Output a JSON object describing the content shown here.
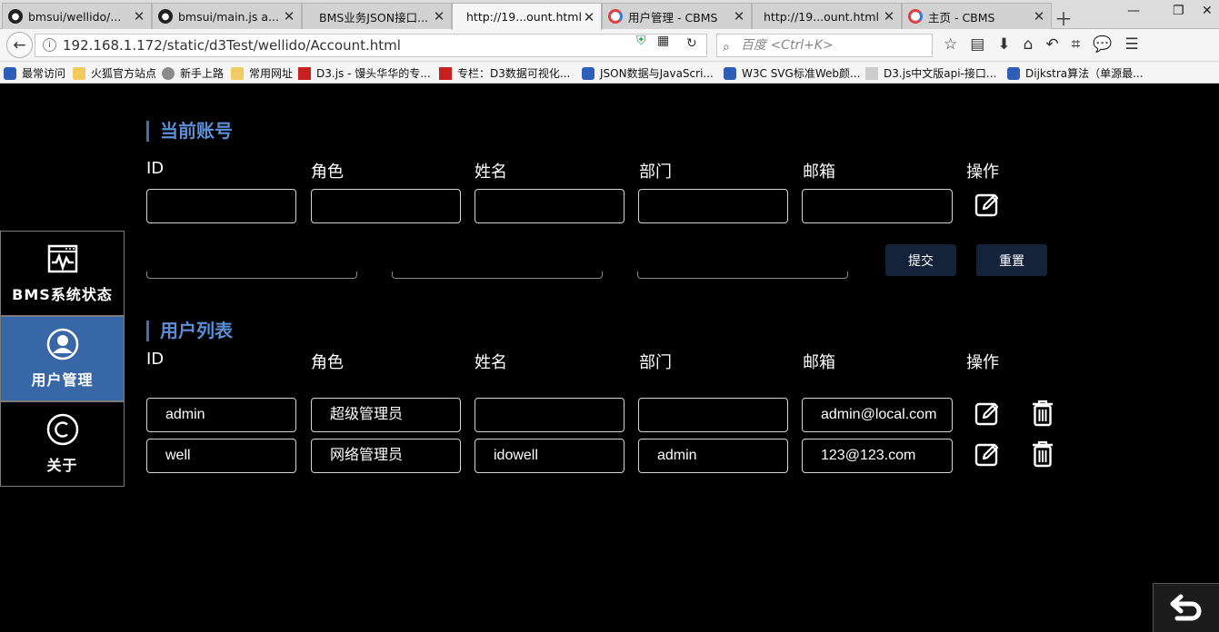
{
  "browser": {
    "tabs": [
      {
        "label": "bmsui/wellido/...",
        "icon": "github-icon"
      },
      {
        "label": "bmsui/main.js a...",
        "icon": "github-icon"
      },
      {
        "label": "BMS业务JSON接口...",
        "icon": ""
      },
      {
        "label": "http://19...ount.html",
        "icon": ""
      },
      {
        "label": "用户管理 - CBMS",
        "icon": "cbms-icon"
      },
      {
        "label": "http://19...ount.html",
        "icon": ""
      },
      {
        "label": "主页 - CBMS",
        "icon": "cbms-icon"
      }
    ],
    "url": "192.168.1.172/static/d3Test/wellido/Account.html",
    "search_placeholder": "百度 <Ctrl+K>",
    "bookmarks": [
      "最常访问",
      "火狐官方站点",
      "新手上路",
      "常用网址",
      "D3.js - 馒头华华的专...",
      "专栏：D3数据可视化...",
      "JSON数据与JavaScri...",
      "W3C SVG标准Web颜...",
      "D3.js中文版api-接口...",
      "Dijkstra算法（单源最..."
    ]
  },
  "sidebar": {
    "items": [
      {
        "label": "BMS系统状态",
        "icon": "monitor-wave-icon",
        "active": false
      },
      {
        "label": "用户管理",
        "icon": "user-icon",
        "active": true
      },
      {
        "label": "关于",
        "icon": "copyright-icon",
        "active": false
      }
    ]
  },
  "current_account": {
    "title": "当前账号",
    "headers": [
      "ID",
      "角色",
      "姓名",
      "部门",
      "邮箱",
      "操作"
    ],
    "values": [
      "",
      "",
      "",
      "",
      ""
    ],
    "submit_label": "提交",
    "reset_label": "重置"
  },
  "user_list": {
    "title": "用户列表",
    "headers": [
      "ID",
      "角色",
      "姓名",
      "部门",
      "邮箱",
      "操作"
    ],
    "rows": [
      {
        "id": "admin",
        "role": "超级管理员",
        "name": "",
        "dept": "",
        "email": "admin@local.com"
      },
      {
        "id": "well",
        "role": "网络管理员",
        "name": "idowell",
        "dept": "admin",
        "email": "123@123.com"
      }
    ]
  },
  "colors": {
    "accent": "#5b8ed6",
    "sidebar_active": "#3767a6",
    "button_bg": "#14233a"
  }
}
